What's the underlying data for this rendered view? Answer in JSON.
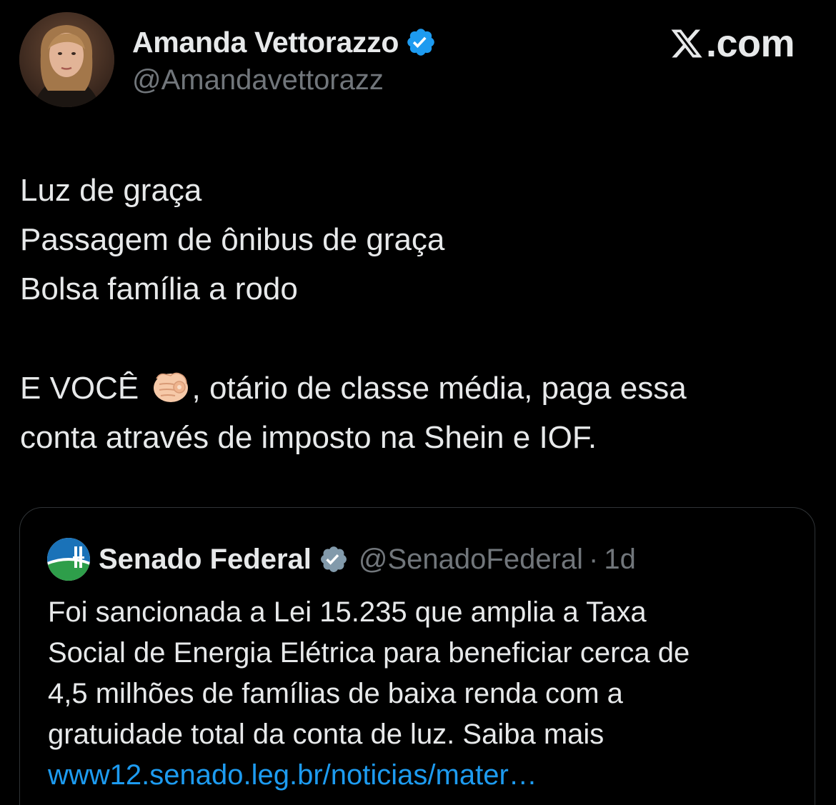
{
  "author": {
    "display_name": "Amanda Vettorazzo",
    "handle": "@Amandavettorazz",
    "verified_icon": "verified-badge-icon",
    "verified_color": "#1d9bf0"
  },
  "brand": {
    "logo_text": ".com"
  },
  "tweet": {
    "lines": [
      "Luz de graça",
      "Passagem de ônibus de graça",
      "Bolsa família a rodo"
    ],
    "line4_before": "E VOCÊ ",
    "line4_emoji": "pointing-at-viewer-emoji",
    "line4_after": ", otário de classe média, paga essa",
    "line5": "conta através de imposto na Shein e IOF."
  },
  "quote": {
    "display_name": "Senado Federal",
    "handle": "@SenadoFederal",
    "separator": "·",
    "time": "1d",
    "verified_icon": "gray-verified-badge-icon",
    "verified_color": "#829aab",
    "lines": [
      "Foi sancionada a Lei 15.235 que amplia a Taxa",
      "Social de Energia Elétrica para beneficiar cerca de",
      "4,5 milhões de famílias de baixa renda com a",
      "gratuidade total da conta de luz. Saiba mais"
    ],
    "link": "www12.senado.leg.br/noticias/mater…",
    "link_color": "#1d9bf0"
  }
}
